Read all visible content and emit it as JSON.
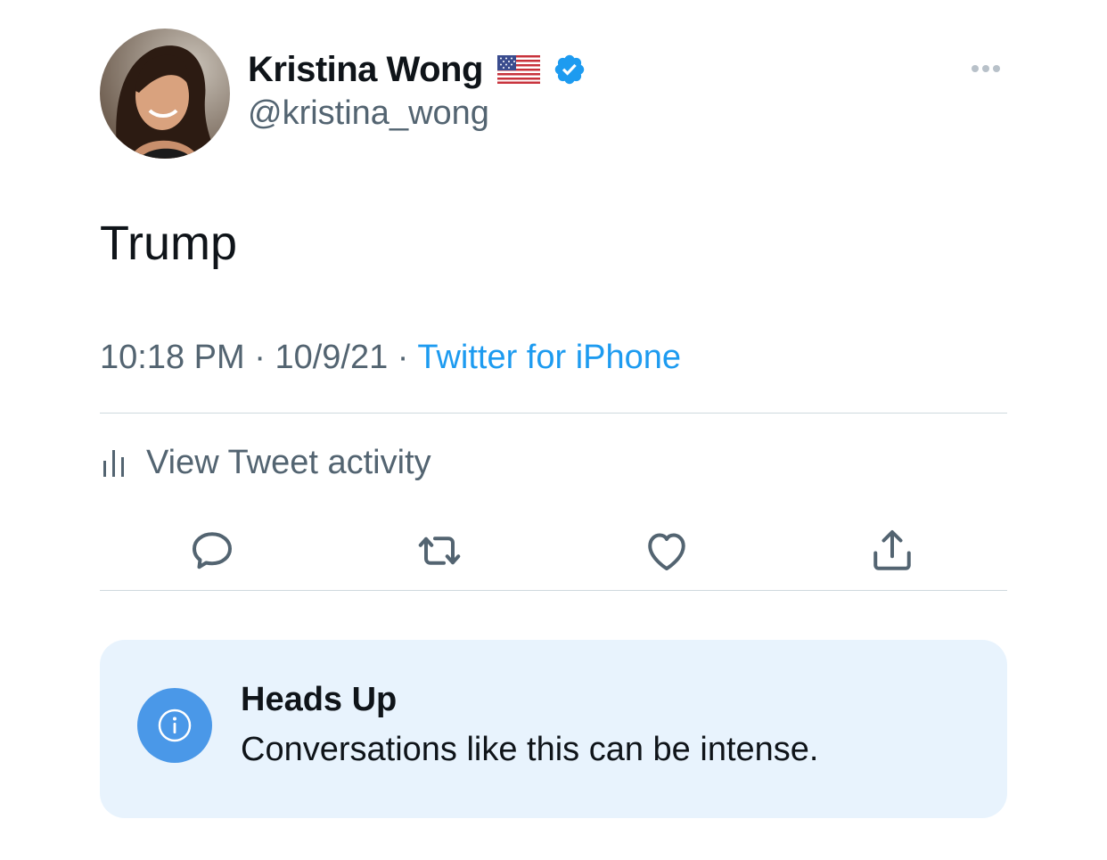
{
  "author": {
    "display_name": "Kristina Wong",
    "handle": "@kristina_wong",
    "flag_icon": "us-flag-icon",
    "verified_icon": "verified-badge-icon"
  },
  "tweet": {
    "text": "Trump",
    "time": "10:18 PM",
    "date": "10/9/21",
    "separator": "·",
    "source": "Twitter for iPhone"
  },
  "activity": {
    "label": "View Tweet activity",
    "icon": "bar-chart-icon"
  },
  "actions": [
    {
      "name": "reply",
      "icon": "reply-icon"
    },
    {
      "name": "retweet",
      "icon": "retweet-icon"
    },
    {
      "name": "like",
      "icon": "heart-icon"
    },
    {
      "name": "share",
      "icon": "share-icon"
    }
  ],
  "notice": {
    "title": "Heads Up",
    "body": "Conversations like this can be intense.",
    "icon": "info-icon"
  },
  "colors": {
    "text": "#0f1419",
    "secondary": "#536471",
    "accent": "#1d9bf0",
    "verified": "#1d9bf0",
    "divider": "#cfd9de",
    "notice_bg": "#e8f3fd",
    "notice_icon": "#4a98e8"
  }
}
